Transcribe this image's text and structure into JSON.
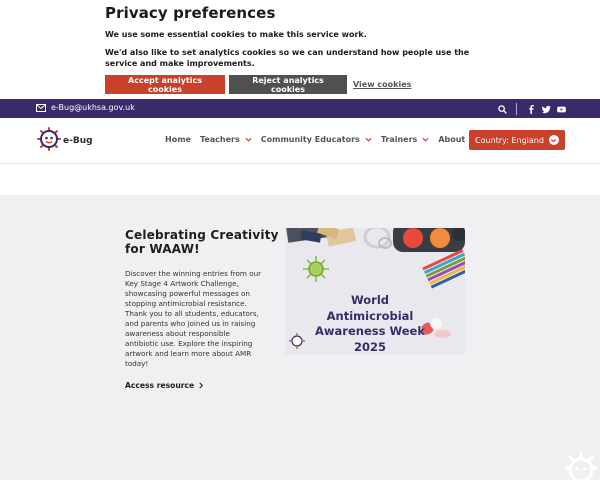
{
  "cookie": {
    "title": "Privacy preferences",
    "line1": "We use some essential cookies to make this service work.",
    "line2": "We'd also like to set analytics cookies so we can understand how people use the service and make improvements.",
    "accept_label": "Accept analytics cookies",
    "reject_label": "Reject analytics cookies",
    "view_label": "View cookies"
  },
  "topbar": {
    "email": "e-Bug@ukhsa.gov.uk",
    "icons": [
      "search-icon",
      "facebook-icon",
      "twitter-icon",
      "youtube-icon"
    ]
  },
  "nav": {
    "logo_text": "e-Bug",
    "items": [
      {
        "label": "Home",
        "has_dropdown": false
      },
      {
        "label": "Teachers",
        "has_dropdown": true
      },
      {
        "label": "Community Educators",
        "has_dropdown": true
      },
      {
        "label": "Trainers",
        "has_dropdown": true
      },
      {
        "label": "About",
        "has_dropdown": true
      }
    ],
    "country_label": "Country: England"
  },
  "feature": {
    "title": "Celebrating Creativity for WAAW!",
    "description": "Discover the winning entries from our Key Stage 4 Artwork Challenge, showcasing powerful messages on stopping antimicrobial resistance. Thank you to all students, educators, and parents who joined us in raising awareness about responsible antibiotic use. Explore the inspiring artwork and learn more about AMR today!",
    "link_label": "Access resource",
    "poster_lines": [
      "World",
      "Antimicrobial",
      "Awareness Week",
      "2025"
    ]
  },
  "colors": {
    "accent": "#c9412a",
    "brand_purple": "#3b2a6a",
    "section_bg": "#f0f0f3"
  }
}
